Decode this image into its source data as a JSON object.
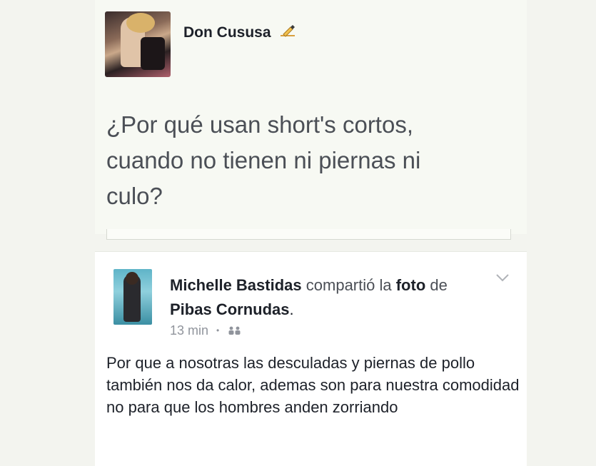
{
  "top_post": {
    "author_name": "Don Cususa",
    "author_icon": "writing-hand-icon",
    "text": "¿Por qué usan short's cortos,\ncuando no tienen ni piernas ni\nculo?"
  },
  "shared_post": {
    "author_name": "Michelle Bastidas",
    "shared_verb": "compartió la",
    "object_word": "foto",
    "preposition": "de",
    "page_name": "Pibas Cornudas",
    "period": ".",
    "timestamp": "13 min",
    "separator": "•",
    "audience_icon": "friends-icon",
    "menu_icon": "chevron-down-icon",
    "text": "Por que a nosotras las desculadas y piernas de pollo también nos da calor, ademas son para nuestra comodidad no para que los hombres anden zorriando"
  },
  "colors": {
    "page_background": "#f3f4ef",
    "card_background": "#ffffff",
    "primary_text": "#1d2129",
    "secondary_text": "#90949c"
  }
}
